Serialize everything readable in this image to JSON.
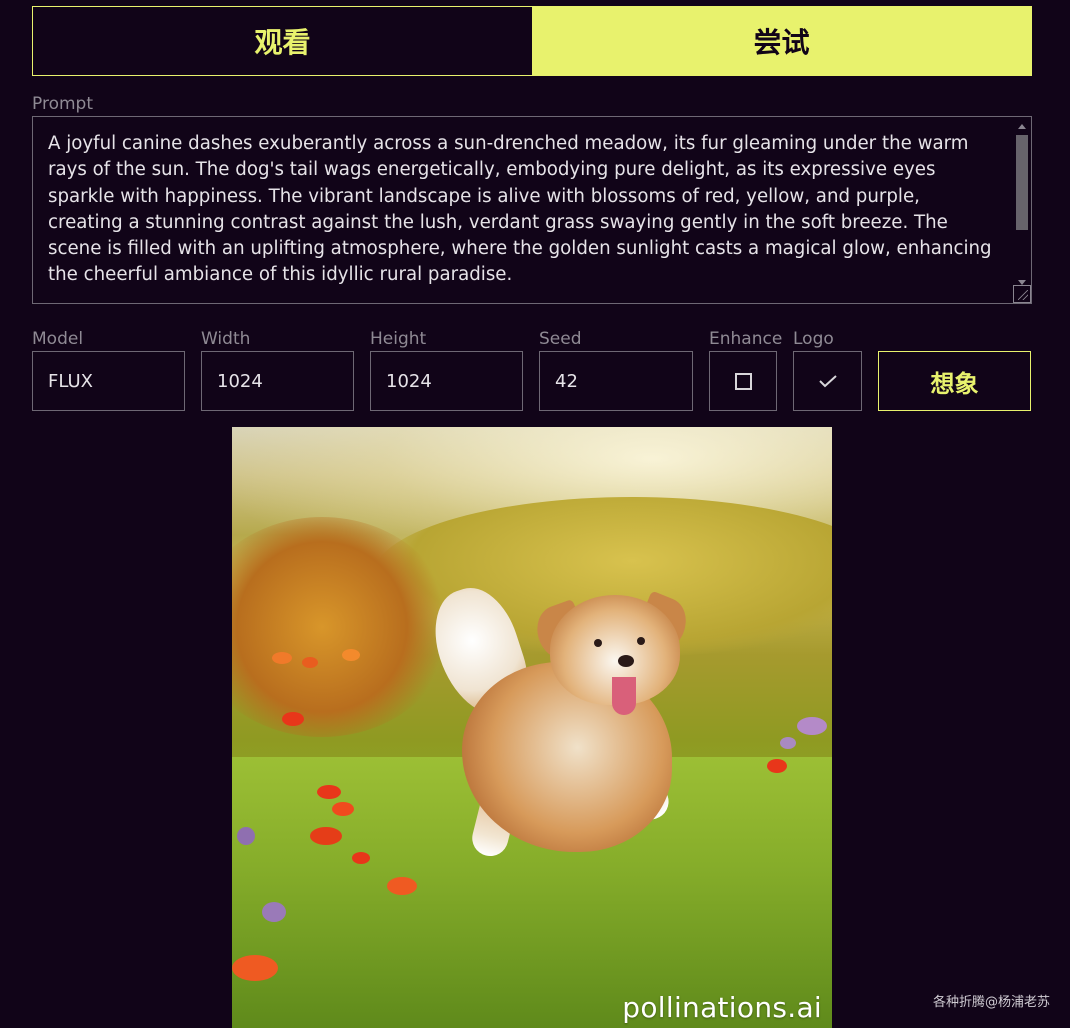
{
  "tabs": [
    {
      "label": "观看",
      "active": false
    },
    {
      "label": "尝试",
      "active": true
    }
  ],
  "prompt": {
    "label": "Prompt",
    "value": "A joyful canine dashes exuberantly across a sun-drenched meadow, its fur gleaming under the warm rays of the sun. The dog's tail wags energetically, embodying pure delight, as its expressive eyes sparkle with happiness. The vibrant landscape is alive with blossoms of red, yellow, and purple, creating a stunning contrast against the lush, verdant grass swaying gently in the soft breeze. The scene is filled with an uplifting atmosphere, where the golden sunlight casts a magical glow, enhancing the cheerful ambiance of this idyllic rural paradise."
  },
  "fields": {
    "model": {
      "label": "Model",
      "value": "FLUX"
    },
    "width": {
      "label": "Width",
      "value": "1024"
    },
    "height": {
      "label": "Height",
      "value": "1024"
    },
    "seed": {
      "label": "Seed",
      "value": "42"
    },
    "enhance": {
      "label": "Enhance",
      "checked": false
    },
    "logo": {
      "label": "Logo",
      "checked": true
    }
  },
  "imagine_button": "想象",
  "image": {
    "watermark": "pollinations.ai"
  },
  "credit": "各种折腾@杨浦老苏",
  "colors": {
    "background": "#110418",
    "accent": "#e8f26d",
    "border": "#6e6874",
    "label": "#8f8a94"
  }
}
